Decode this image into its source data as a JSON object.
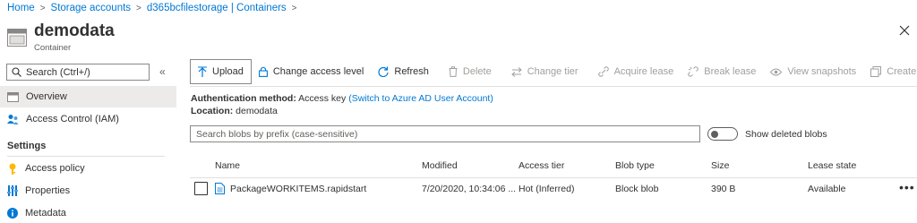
{
  "breadcrumb": {
    "items": [
      "Home",
      "Storage accounts",
      "d365bcfilestorage | Containers"
    ],
    "separator": ">"
  },
  "header": {
    "title": "demodata",
    "subtitle": "Container"
  },
  "sidebar": {
    "search_placeholder": "Search (Ctrl+/)",
    "collapse_glyph": "«",
    "items": [
      {
        "label": "Overview",
        "icon": "overview-icon",
        "selected": true
      },
      {
        "label": "Access Control (IAM)",
        "icon": "iam-icon"
      }
    ],
    "settings_heading": "Settings",
    "settings_items": [
      {
        "label": "Access policy",
        "icon": "key-icon"
      },
      {
        "label": "Properties",
        "icon": "properties-icon"
      },
      {
        "label": "Metadata",
        "icon": "info-icon"
      }
    ]
  },
  "toolbar": {
    "upload": "Upload",
    "change_access_level": "Change access level",
    "refresh": "Refresh",
    "delete": "Delete",
    "change_tier": "Change tier",
    "acquire_lease": "Acquire lease",
    "break_lease": "Break lease",
    "view_snapshots": "View snapshots",
    "create_snapshot": "Create snapshot"
  },
  "info": {
    "auth_label": "Authentication method:",
    "auth_value": "Access key",
    "auth_link": "(Switch to Azure AD User Account)",
    "location_label": "Location:",
    "location_value": "demodata"
  },
  "blob_search": {
    "placeholder": "Search blobs by prefix (case-sensitive)"
  },
  "show_deleted": {
    "label": "Show deleted blobs",
    "on": false
  },
  "table": {
    "columns": [
      "Name",
      "Modified",
      "Access tier",
      "Blob type",
      "Size",
      "Lease state"
    ],
    "rows": [
      {
        "name": "PackageWORKITEMS.rapidstart",
        "modified": "7/20/2020, 10:34:06 ...",
        "access_tier": "Hot (Inferred)",
        "blob_type": "Block blob",
        "size": "390 B",
        "lease_state": "Available",
        "more": "•••"
      }
    ]
  },
  "colors": {
    "accent": "#0078d4",
    "text": "#323130",
    "disabled": "#a19f9d",
    "selected_bg": "#edebe9"
  }
}
